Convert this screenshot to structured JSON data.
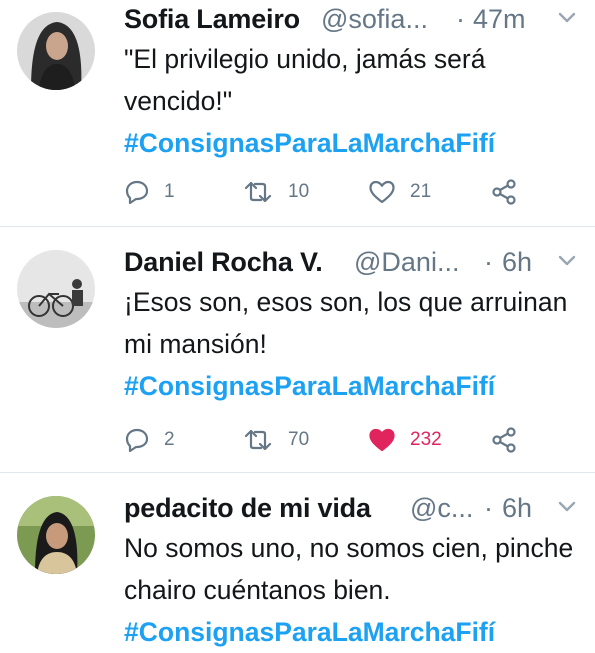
{
  "tweets": [
    {
      "name": "Sofia Lameiro",
      "handle": "@sofia...",
      "separator": "·",
      "time": "47m",
      "text": "\"El privilegio unido, jamás será vencido!\"",
      "hashtag": "#ConsignasParaLaMarchaFifí",
      "replies": "1",
      "retweets": "10",
      "likes": "21",
      "liked": false
    },
    {
      "name": "Daniel Rocha V.",
      "handle": "@Dani...",
      "separator": "·",
      "time": "6h",
      "text": "¡Esos son, esos son, los que arruinan mi mansión!",
      "hashtag": "#ConsignasParaLaMarchaFifí",
      "replies": "2",
      "retweets": "70",
      "likes": "232",
      "liked": true
    },
    {
      "name": "pedacito de mi vida",
      "handle": "@c...",
      "separator": "·",
      "time": "6h",
      "text": "No somos uno, no somos cien, pinche chairo cuéntanos bien.",
      "hashtag": "#ConsignasParaLaMarchaFifí"
    }
  ],
  "colors": {
    "link": "#1da1f2",
    "muted": "#657786",
    "like": "#e0245e",
    "divider": "#e1e8ed"
  },
  "icons": [
    "reply-icon",
    "retweet-icon",
    "heart-icon",
    "share-icon",
    "chevron-down-icon"
  ]
}
